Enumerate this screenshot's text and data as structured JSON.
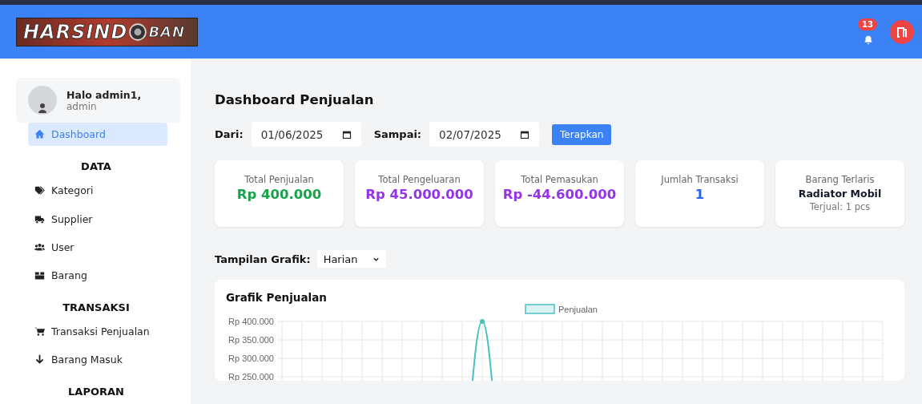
{
  "header": {
    "logo": {
      "word_1": "HARSIND",
      "word_2": "BAN"
    },
    "notification_count": "13"
  },
  "sidebar": {
    "user": {
      "greeting": "Halo admin1,",
      "role": "admin"
    },
    "items": [
      {
        "kind": "link",
        "label": "Dashboard",
        "selected": true
      },
      {
        "kind": "heading",
        "label": "DATA"
      },
      {
        "kind": "link",
        "label": "Kategori",
        "selected": false
      },
      {
        "kind": "link",
        "label": "Supplier",
        "selected": false
      },
      {
        "kind": "link",
        "label": "User",
        "selected": false
      },
      {
        "kind": "link",
        "label": "Barang",
        "selected": false
      },
      {
        "kind": "heading",
        "label": "TRANSAKSI"
      },
      {
        "kind": "link",
        "label": "Transaksi Penjualan",
        "selected": false
      },
      {
        "kind": "link",
        "label": "Barang Masuk",
        "selected": false
      },
      {
        "kind": "heading",
        "label": "LAPORAN"
      }
    ]
  },
  "main": {
    "title": "Dashboard Penjualan",
    "filter": {
      "from_label": "Dari:",
      "from_value": "01/06/2025",
      "to_label": "Sampai:",
      "to_value": "02/07/2025",
      "apply_button": "Terapkan"
    },
    "cards": [
      {
        "label": "Total Penjualan",
        "value": "Rp 400.000",
        "color": "#16a34a"
      },
      {
        "label": "Total Pengeluaran",
        "value": "Rp 45.000.000",
        "color": "#9333ea"
      },
      {
        "label": "Total Pemasukan",
        "value": "Rp -44.600.000",
        "color": "#9333ea"
      },
      {
        "label": "Jumlah Transaksi",
        "value": "1",
        "color": "#2563eb"
      },
      {
        "label": "Barang Terlaris",
        "value": "Radiator Mobil",
        "color": "#111827",
        "note": "Terjual: 1 pcs"
      }
    ],
    "view": {
      "label": "Tampilan Grafik:",
      "value": "Harian"
    },
    "chart": {
      "title": "Grafik Penjualan",
      "legend": "Penjualan",
      "y_axis_labels": [
        "Rp 400.000",
        "Rp 350.000",
        "Rp 300.000",
        "Rp 250.000"
      ]
    }
  }
}
